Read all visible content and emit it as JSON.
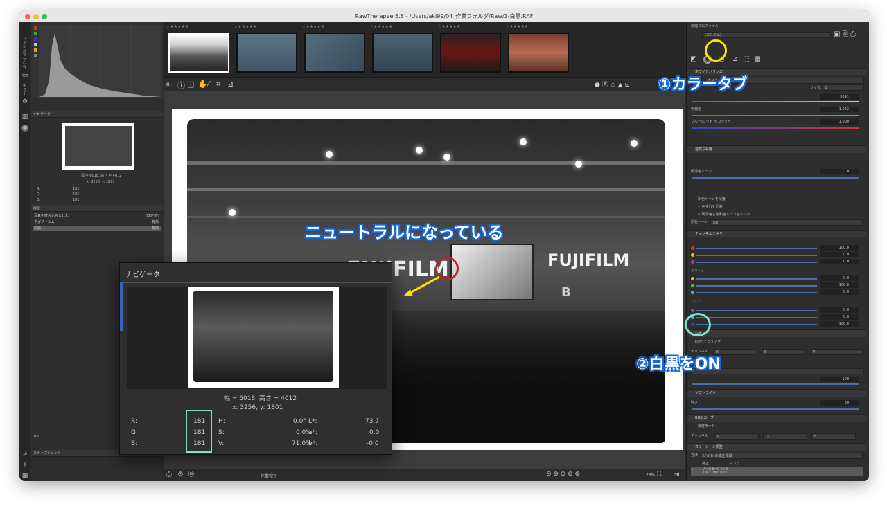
{
  "window": {
    "title": "RawTherapee 5.8 - /Users/aki99/04_作業フォルダ/Raw/1-白黒.RAF"
  },
  "left_strip": {
    "tab_file_browser": "ファイルブラウザ",
    "tab_queue": "キュー"
  },
  "left_panel": {
    "navigator_title": "ナビゲータ",
    "size_text": "幅 = 6018, 高さ = 4012",
    "coord_text": "x: 3256, y: 1801",
    "rgb": [
      {
        "label": "R:",
        "value": "181",
        "hsv_label": "H:",
        "hsv_value": "0.0°",
        "lab_label": "L*:",
        "lab_value": "73.7"
      },
      {
        "label": "G:",
        "value": "181",
        "hsv_label": "S:",
        "hsv_value": "0.0%",
        "lab_label": "a*:",
        "lab_value": "0.0"
      },
      {
        "label": "B:",
        "value": "181",
        "hsv_label": "V:",
        "hsv_value": "71.0%",
        "lab_label": "b*:",
        "lab_value": "-0.0"
      }
    ],
    "history_title": "履歴",
    "history": [
      {
        "label": "写真を読み込みました",
        "value": "(既定値)"
      },
      {
        "label": "ネガフィルム",
        "value": "有効"
      },
      {
        "label": "白黒",
        "value": "有効"
      }
    ],
    "snapshot_title": "スナップショット",
    "snapshot_add": "+",
    "snapshot_remove": "−",
    "zoom_pct": "0%"
  },
  "filmstrip": {
    "stars": "☆★★★★★",
    "thumbs": [
      {
        "name": "thumb-1",
        "selected": true
      },
      {
        "name": "thumb-2",
        "selected": false
      },
      {
        "name": "thumb-3",
        "selected": false
      },
      {
        "name": "thumb-4",
        "selected": false
      },
      {
        "name": "thumb-5",
        "selected": false
      },
      {
        "name": "thumb-6",
        "selected": false
      }
    ]
  },
  "photo": {
    "logo_big": "FUJIFILM",
    "logo_left": "FUJIFILM",
    "logo_b": "B"
  },
  "bottom_toolbar": {
    "status": "作業完了",
    "zoom": "23%"
  },
  "right_panel": {
    "profile_title": "処理プロファイル",
    "profile_value": "(カスタム)",
    "wb_title": "ホワイトバランス",
    "wb_method_label": "モード",
    "wb_method_value": "カメラ",
    "wb_size_label": "サイズ:",
    "wb_size_value": "8",
    "temp_value": "5091",
    "tint_label": "色偏差",
    "tint_value": "1.022",
    "blue_red_label": "ブルー/レッド イコライザ",
    "blue_red_value": "1.000",
    "natural_title": "自然な彩度",
    "pastel_label": "明清色トーン",
    "pastel_value": "0",
    "protect_skin": "肌色トーンを保護",
    "avoid_shift": "色ずれを回避",
    "link_tones": "明清色と飽和色トーンをリンク",
    "skin_tone_label": "肌色トーン",
    "skin_tone_value": "HH",
    "channel_mixer_title": "チャンネルミキサー",
    "mixer_values_1": [
      "100.0",
      "0.0",
      "0.0"
    ],
    "green_label": "グリーン",
    "mixer_values_2": [
      "0.0",
      "100.0",
      "0.0"
    ],
    "blue_label": "ブルー",
    "mixer_values_3": [
      "0.0",
      "0.0",
      "100.0"
    ],
    "bw_title": "白黒",
    "hsv_eq": "HSV イコライザ",
    "channel_label": "チャンネル",
    "channel_h": "H",
    "channel_s": "S",
    "channel_v": "V",
    "dash": "—",
    "contrast_value": "100",
    "soft_light_title": "ソフトライト",
    "strength_label": "強さ",
    "strength_value": "30",
    "rgb_curve_title": "RGB カーブ",
    "lum_mode": "輝度モード",
    "curve_channel": "チャンネル",
    "curve_r": "R",
    "curve_g": "G",
    "curve_b": "B",
    "color_toning_title": "カラートーン調整",
    "toning_method_label": "方法",
    "toning_method_value": "L*a*b*の補正領域",
    "toning_cols": [
      "補正",
      "マスク"
    ],
    "toning_row": "1",
    "toning_row_text_1": "A=0 B=0 S=0",
    "toning_row_text_2": "0=1 0=0 0=1"
  },
  "annotations": {
    "color_tab": "①カラータブ",
    "neutral": "ニュートラルになっている",
    "bw_on": "②白黒をON",
    "colors": {
      "yellow_ring": "#f5e400",
      "green_ring": "#7fe0c6",
      "red_ring": "#c4202b",
      "blue_text": "#1a6ad8",
      "arrow": "#f5e400"
    }
  }
}
